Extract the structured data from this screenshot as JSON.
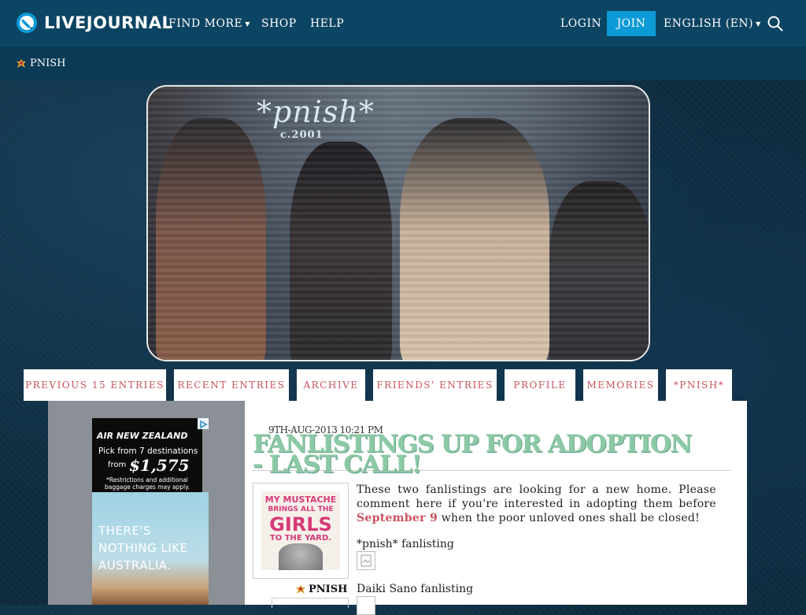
{
  "topbar": {
    "brand": "LIVEJOURNAL",
    "nav": {
      "find_more": "FIND MORE",
      "shop": "SHOP",
      "help": "HELP"
    },
    "login": "LOGIN",
    "join": "JOIN",
    "language": "ENGLISH (EN)"
  },
  "journal": {
    "name": "PNISH"
  },
  "header": {
    "title": "*pnish*",
    "subtitle": "c.2001"
  },
  "tabs": [
    {
      "label": "PREVIOUS 15 ENTRIES"
    },
    {
      "label": "RECENT ENTRIES"
    },
    {
      "label": "ARCHIVE"
    },
    {
      "label": "FRIENDS' ENTRIES"
    },
    {
      "label": "PROFILE"
    },
    {
      "label": "MEMORIES"
    },
    {
      "label": "*PNISH*"
    }
  ],
  "ad": {
    "brand": "AIR NEW ZEALAND",
    "pick": "Pick from 7 destinations",
    "from": "from",
    "price": "$1,575",
    "fine": "*Restrictions and additional baggage charges may apply.",
    "tagline": "THERE'S NOTHING LIKE AUSTRALIA."
  },
  "entry": {
    "date": "9TH-AUG-2013 10:21 PM",
    "title": "FANLISTINGS UP FOR ADOPTION - LAST CALL!",
    "body_before": "These two fanlistings are looking for a new home. Please comment here if you're interested in adopting them before",
    "body_highlight": "September 9",
    "body_after": "when the poor unloved ones shall be closed!",
    "item1": "*pnish* fanlisting",
    "item2": "Daiki Sano fanlisting",
    "poster": "PNISH",
    "userpic": {
      "line1": "MY MUSTACHE",
      "line2": "BRINGS ALL THE",
      "line3": "GIRLS",
      "line4": "TO THE YARD."
    }
  },
  "colors": {
    "accent": "#c9525f",
    "title_green": "#8cc9a6",
    "join_blue": "#0c9ad6",
    "topbar": "#0c4463"
  }
}
